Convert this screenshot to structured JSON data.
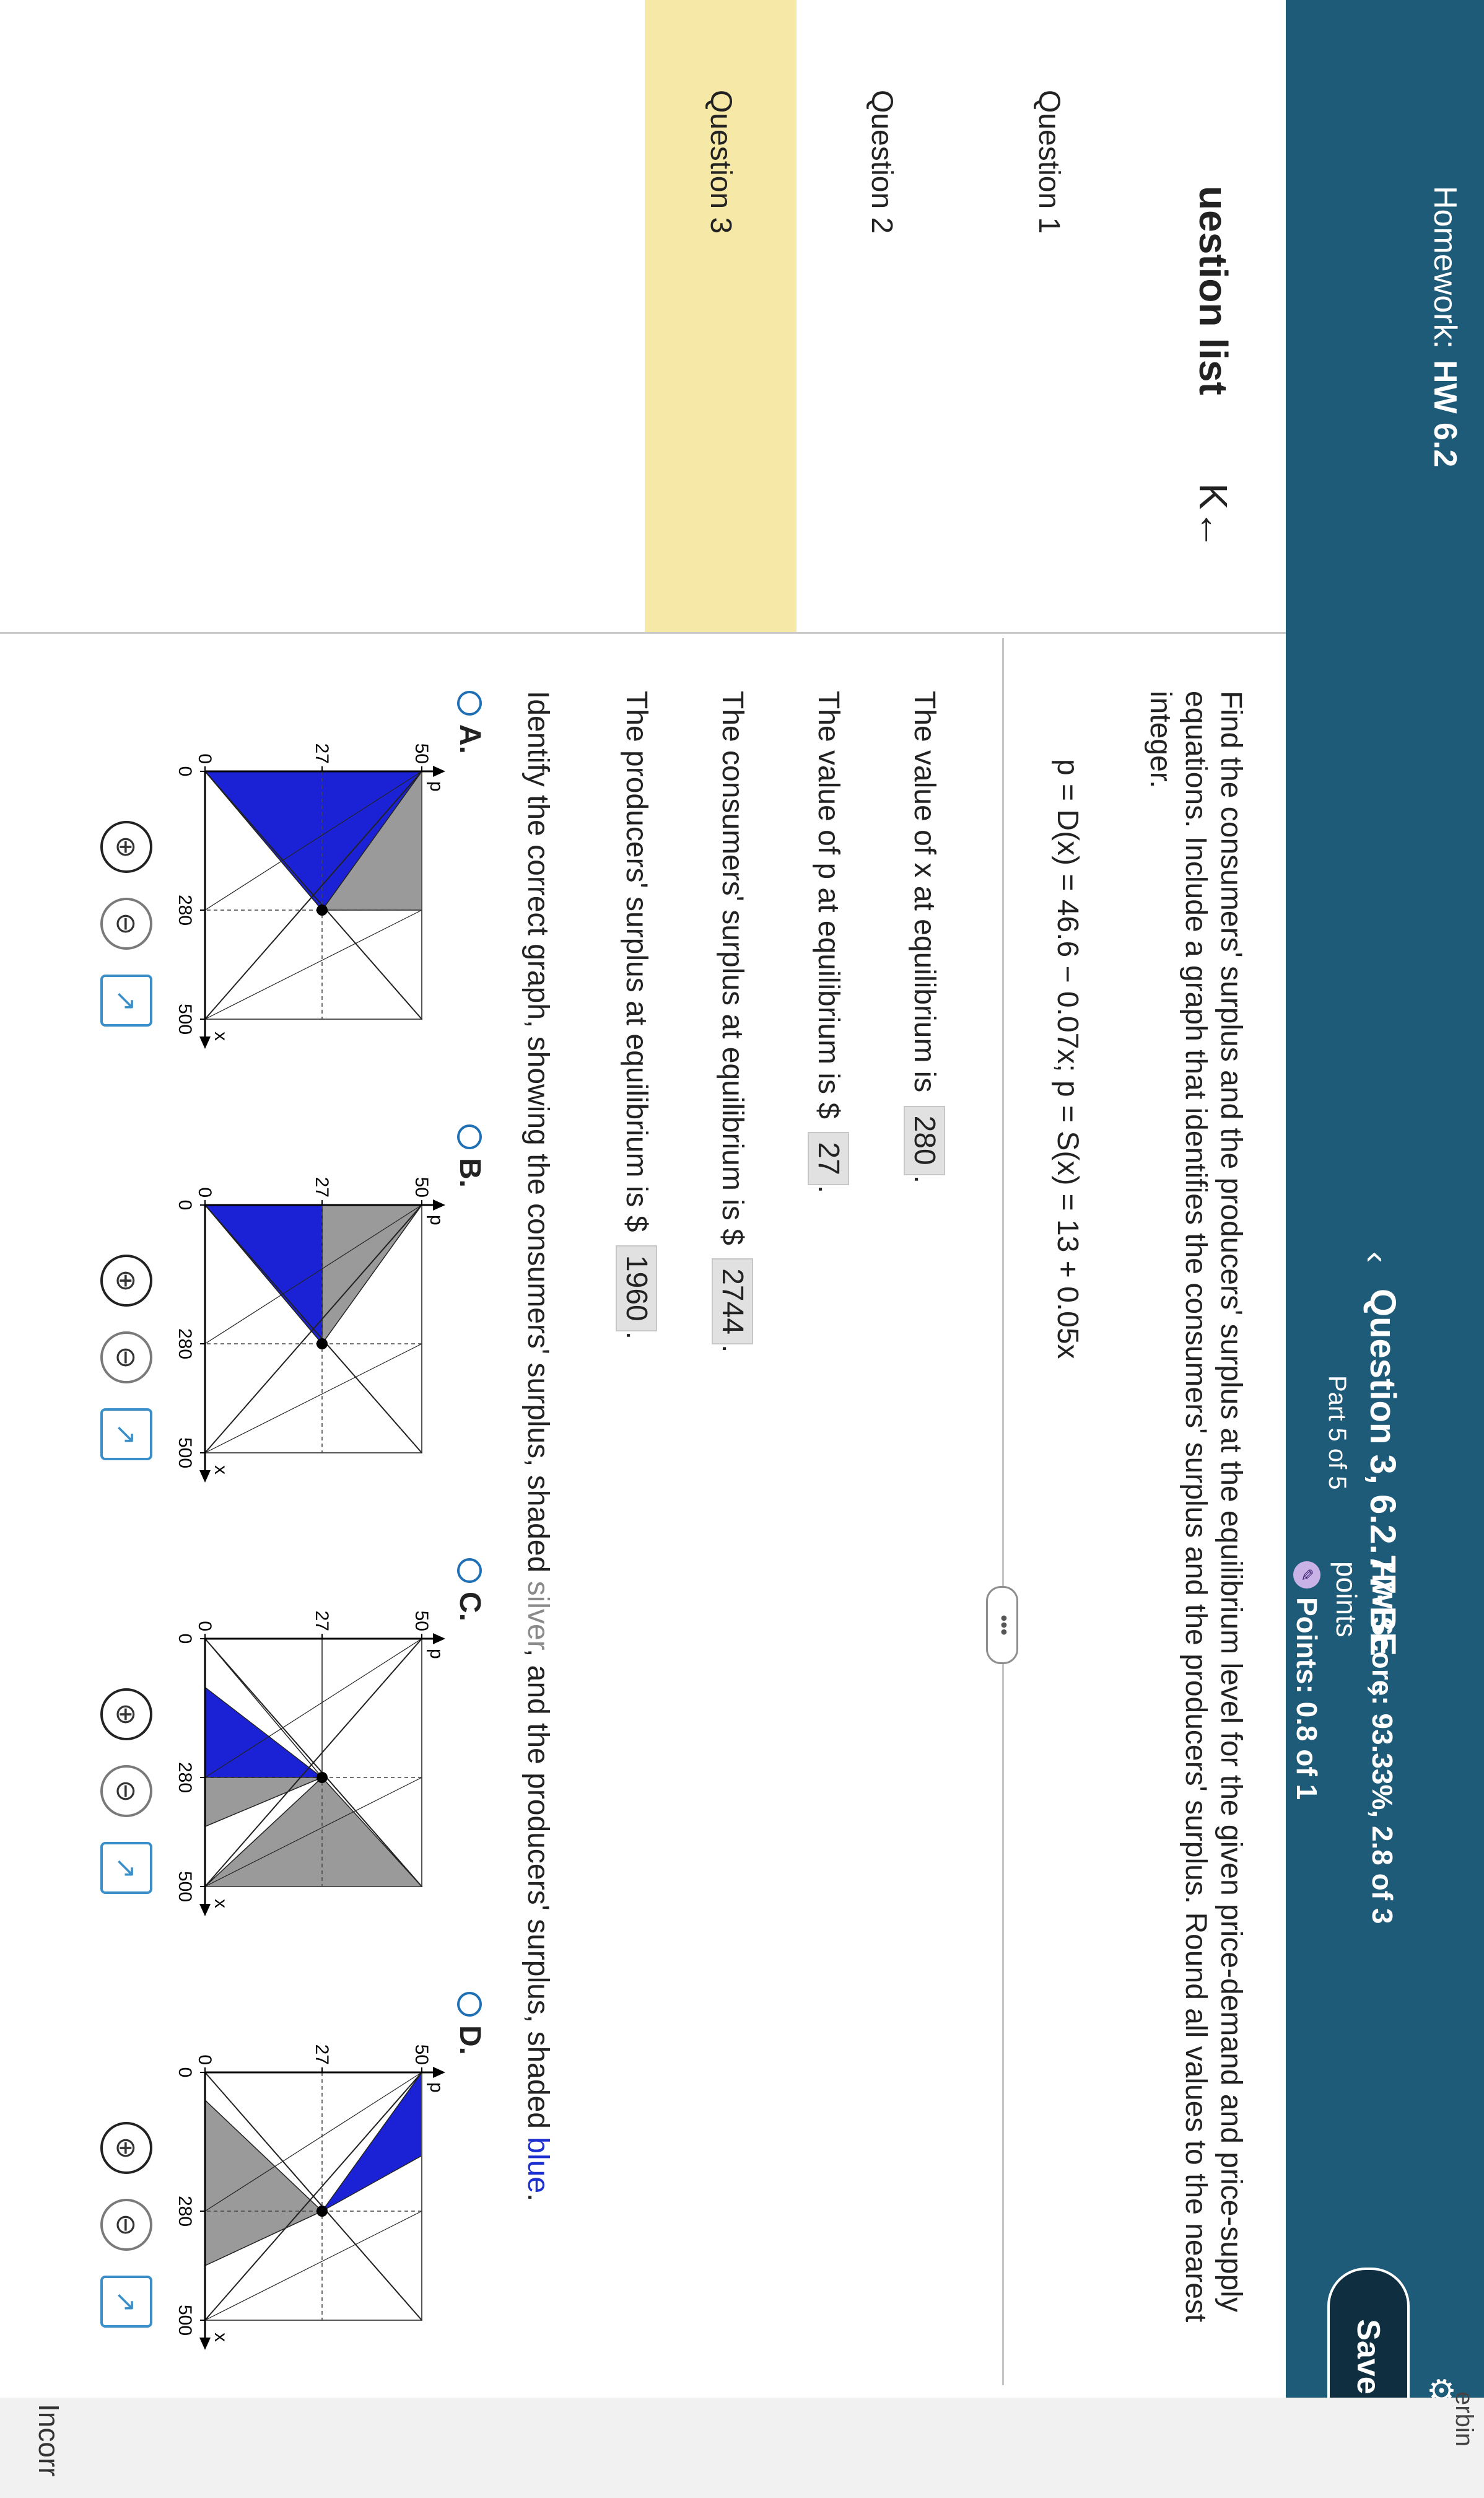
{
  "header": {
    "homework_label": "Homework:",
    "homework_name": "HW 6.2",
    "question_title": "Question 3, 6.2.77-BE",
    "question_part": "Part 5 of 5",
    "prev_icon": "‹",
    "next_icon": "›",
    "hw_score": "HW Score: 93.33%, 2.8 of 3",
    "hw_score_unit": "points",
    "points": "Points: 0.8 of 1",
    "save_label": "Save",
    "user_partial": "erbin",
    "incorrect_partial": "Incorr"
  },
  "sidebar": {
    "title": "uestion list",
    "collapse_icon": "K←",
    "items": [
      {
        "label": "Question 1"
      },
      {
        "label": "Question 2"
      },
      {
        "label": "Question 3"
      }
    ]
  },
  "question": {
    "prompt": "Find the consumers' surplus and the producers' surplus at the equilibrium level for the given price-demand and price-supply equations. Include a graph that identifies the consumers' surplus and the producers' surplus. Round all values to the nearest integer.",
    "equation": "p = D(x) = 46.6 − 0.07x;  p = S(x) = 13 + 0.05x",
    "more_label": "•••",
    "answers": [
      {
        "text": "The value of x at equilibrium is",
        "prefix": "",
        "value": "280"
      },
      {
        "text": "The value of p at equilibrium is",
        "prefix": "$",
        "value": "27"
      },
      {
        "text": "The consumers' surplus at equilibrium is",
        "prefix": "$",
        "value": "2744"
      },
      {
        "text": "The producers' surplus at equilibrium is",
        "prefix": "$",
        "value": "1960"
      }
    ],
    "identify_pre": "Identify the correct graph, showing the consumers' surplus, shaded",
    "identify_silver": "silver",
    "identify_mid": ", and the producers' surplus, shaded",
    "identify_blue": "blue",
    "identify_end": "."
  },
  "options": [
    {
      "label": "A."
    },
    {
      "label": "B."
    },
    {
      "label": "C."
    },
    {
      "label": "D."
    }
  ],
  "chart_data": [
    {
      "type": "area",
      "option": "A",
      "xlim": [
        0,
        500
      ],
      "ylim": [
        0,
        50
      ],
      "x_ticks": [
        "0",
        "280",
        "500"
      ],
      "y_ticks": [
        "0",
        "27",
        "50"
      ],
      "xlabel": "x",
      "ylabel": "p",
      "equilibrium": [
        280,
        27
      ],
      "silver_region": "between demand and supply, x 0–280",
      "blue_region": "above demand, below 50, x 0–280"
    },
    {
      "type": "area",
      "option": "B",
      "xlim": [
        0,
        500
      ],
      "ylim": [
        0,
        50
      ],
      "x_ticks": [
        "0",
        "280",
        "500"
      ],
      "y_ticks": [
        "0",
        "27",
        "50"
      ],
      "xlabel": "x",
      "ylabel": "p",
      "equilibrium": [
        280,
        27
      ],
      "silver_region": "between demand and p=27, x 0–280",
      "blue_region": "between p=27 and supply, x 0–280"
    },
    {
      "type": "area",
      "option": "C",
      "xlim": [
        0,
        500
      ],
      "ylim": [
        0,
        50
      ],
      "x_ticks": [
        "0",
        "280",
        "500"
      ],
      "y_ticks": [
        "0",
        "27",
        "50"
      ],
      "xlabel": "x",
      "ylabel": "p",
      "equilibrium": [
        280,
        27
      ],
      "silver_region": "between supply and demand, x 280–500",
      "blue_region": "below p=27, between supply and demand, x 0–280"
    },
    {
      "type": "area",
      "option": "D",
      "xlim": [
        0,
        500
      ],
      "ylim": [
        0,
        50
      ],
      "x_ticks": [
        "0",
        "280",
        "500"
      ],
      "y_ticks": [
        "0",
        "27",
        "50"
      ],
      "xlabel": "x",
      "ylabel": "p",
      "equilibrium": [
        280,
        27
      ],
      "silver_region": "between supply and demand below p=27, x 280–500",
      "blue_region": "between demand and supply above p=27, x 0–280"
    }
  ],
  "colors": {
    "topbar": "#1e5b78",
    "highlight": "#f6e8a6",
    "silver": "#9a9a9a",
    "blue": "#1b22d6"
  }
}
